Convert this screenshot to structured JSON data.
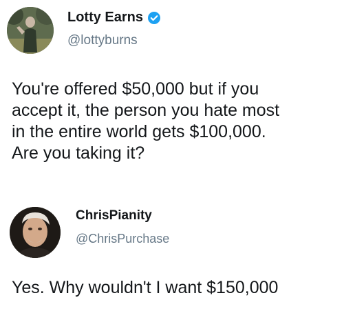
{
  "tweets": [
    {
      "display_name": "Lotty Earns",
      "handle": "@lottyburns",
      "verified": true,
      "text": "You're offered $50,000 but if you\naccept it, the person you hate most\nin the entire world gets $100,000.\nAre you taking it?"
    },
    {
      "display_name": "ChrisPianity",
      "handle": "@ChrisPurchase",
      "verified": false,
      "text": "Yes. Why wouldn't I want $150,000"
    }
  ],
  "colors": {
    "text": "#14171a",
    "secondary": "#657786",
    "verified_blue": "#1da1f2"
  },
  "icons": {
    "verified": "verified-badge-icon"
  }
}
